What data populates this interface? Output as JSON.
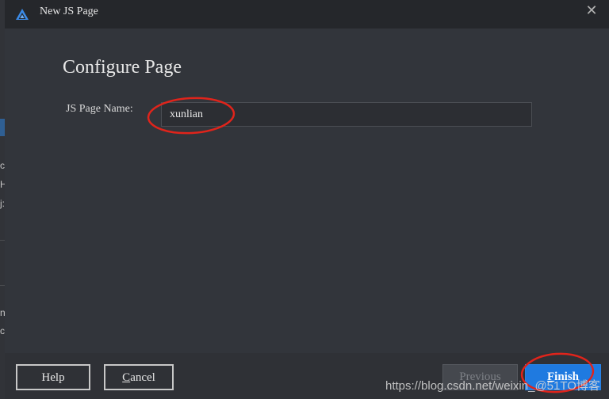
{
  "dialog": {
    "title": "New JS Page",
    "close_glyph": "✕",
    "icon": "harmony-devEco-triangle-icon"
  },
  "page": {
    "heading": "Configure Page",
    "field_label": "JS Page Name:",
    "field_value": "xunlian"
  },
  "footer": {
    "help_label": "Help",
    "cancel_first": "C",
    "cancel_rest": "ancel",
    "previous_first": "P",
    "previous_rest": "revious",
    "finish_first": "F",
    "finish_rest": "inish"
  },
  "background_partial": {
    "chars": [
      "c",
      "H",
      "j:",
      "n",
      "c"
    ]
  },
  "watermark": "https://blog.csdn.net/weixin_@51TO博客",
  "colors": {
    "accent": "#1f7ae0",
    "annotation": "#e0241b",
    "dialog_bg": "#32353b",
    "titlebar_bg": "#25272b"
  }
}
